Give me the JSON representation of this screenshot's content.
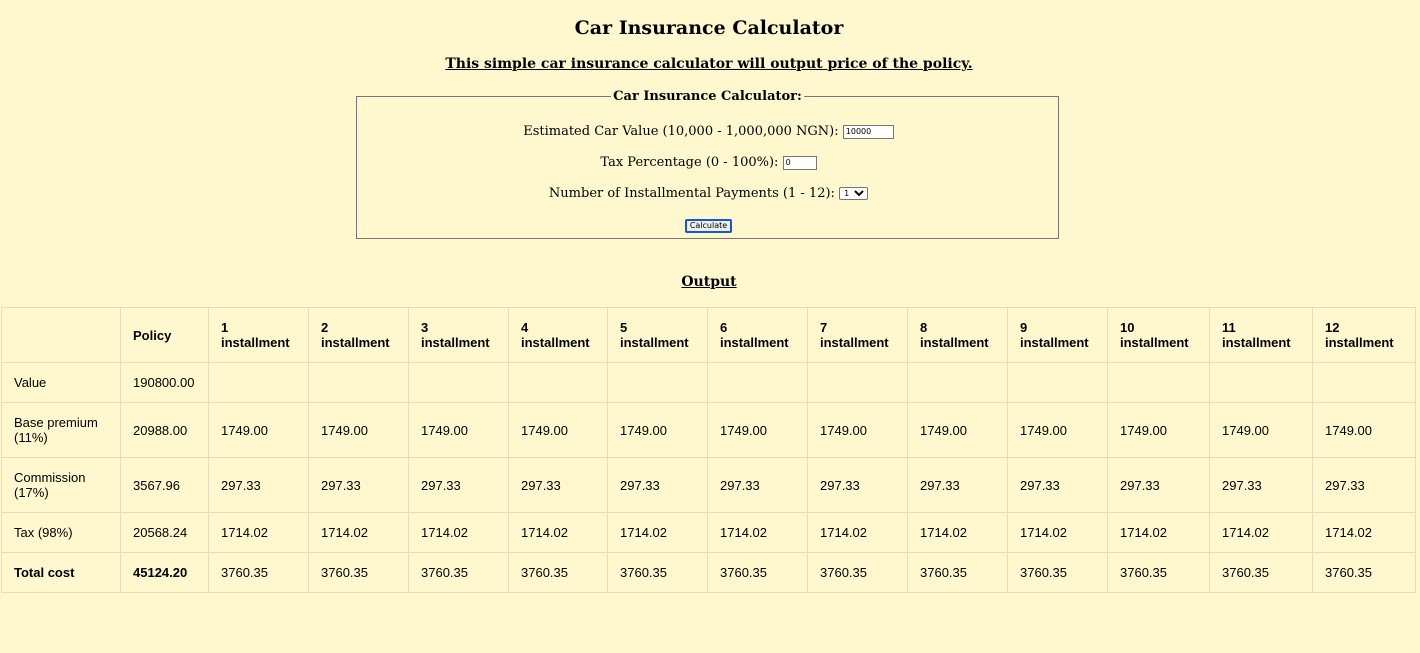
{
  "page": {
    "title": "Car Insurance Calculator",
    "subtitle": "This simple car insurance calculator will output price of the policy."
  },
  "form": {
    "legend": "Car Insurance Calculator:",
    "car_value_label": "Estimated Car Value (10,000 - 1,000,000 NGN):",
    "car_value": "10000",
    "tax_label": "Tax Percentage (0 - 100%):",
    "tax_value": "0",
    "installments_label": "Number of Installmental Payments (1 - 12):",
    "installments_value": "1",
    "calculate_label": "Calculate"
  },
  "output": {
    "title": "Output",
    "headers": [
      "",
      "Policy",
      "1 installment",
      "2 installment",
      "3 installment",
      "4 installment",
      "5 installment",
      "6 installment",
      "7 installment",
      "8 installment",
      "9 installment",
      "10 installment",
      "11 installment",
      "12 installment"
    ],
    "rows": [
      [
        "Value",
        "190800.00",
        "",
        "",
        "",
        "",
        "",
        "",
        "",
        "",
        "",
        "",
        "",
        ""
      ],
      [
        "Base premium (11%)",
        "20988.00",
        "1749.00",
        "1749.00",
        "1749.00",
        "1749.00",
        "1749.00",
        "1749.00",
        "1749.00",
        "1749.00",
        "1749.00",
        "1749.00",
        "1749.00",
        "1749.00"
      ],
      [
        "Commission (17%)",
        "3567.96",
        "297.33",
        "297.33",
        "297.33",
        "297.33",
        "297.33",
        "297.33",
        "297.33",
        "297.33",
        "297.33",
        "297.33",
        "297.33",
        "297.33"
      ],
      [
        "Tax (98%)",
        "20568.24",
        "1714.02",
        "1714.02",
        "1714.02",
        "1714.02",
        "1714.02",
        "1714.02",
        "1714.02",
        "1714.02",
        "1714.02",
        "1714.02",
        "1714.02",
        "1714.02"
      ],
      [
        "Total cost",
        "45124.20",
        "3760.35",
        "3760.35",
        "3760.35",
        "3760.35",
        "3760.35",
        "3760.35",
        "3760.35",
        "3760.35",
        "3760.35",
        "3760.35",
        "3760.35",
        "3760.35"
      ]
    ]
  }
}
